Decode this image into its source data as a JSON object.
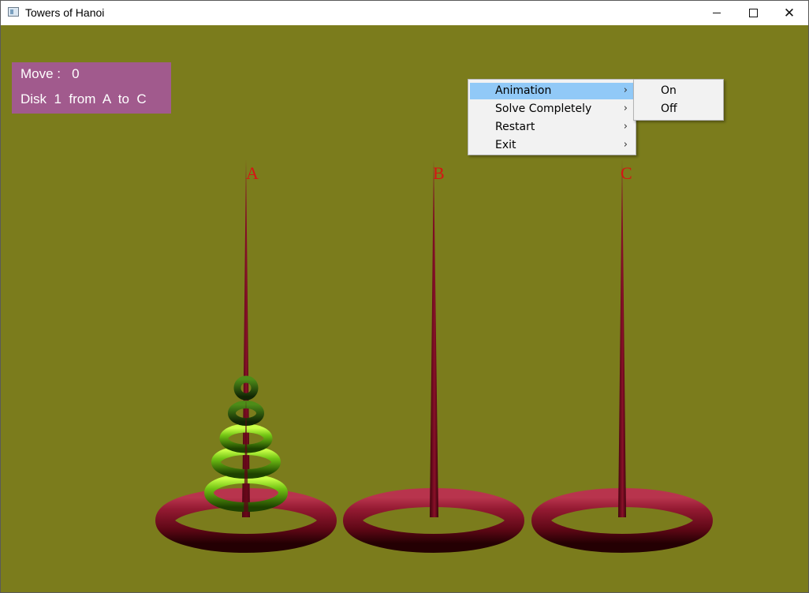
{
  "window": {
    "title": "Towers of Hanoi",
    "controls": {
      "minimize": "minimize-icon",
      "maximize": "maximize-icon",
      "close": "close-icon"
    }
  },
  "hud": {
    "move_line": "Move :   0",
    "disk_line": "Disk  1  from  A  to  C"
  },
  "pegs": [
    "A",
    "B",
    "C"
  ],
  "disks_on_peg_a": 5,
  "context_menu": {
    "items": [
      {
        "label": "Animation",
        "has_submenu": true,
        "highlighted": true
      },
      {
        "label": "Solve Completely",
        "has_submenu": true
      },
      {
        "label": "Restart",
        "has_submenu": true
      },
      {
        "label": "Exit",
        "has_submenu": true
      }
    ],
    "submenu_arrow": "›"
  },
  "animation_submenu": {
    "items": [
      {
        "label": "On"
      },
      {
        "label": "Off"
      }
    ]
  },
  "colors": {
    "background": "#7b7c1c",
    "hud_background": "#a15a8d",
    "peg": "#7d0f24",
    "disk": "#5ea40b",
    "label": "#d61414",
    "menu_highlight": "#91c9f7"
  }
}
